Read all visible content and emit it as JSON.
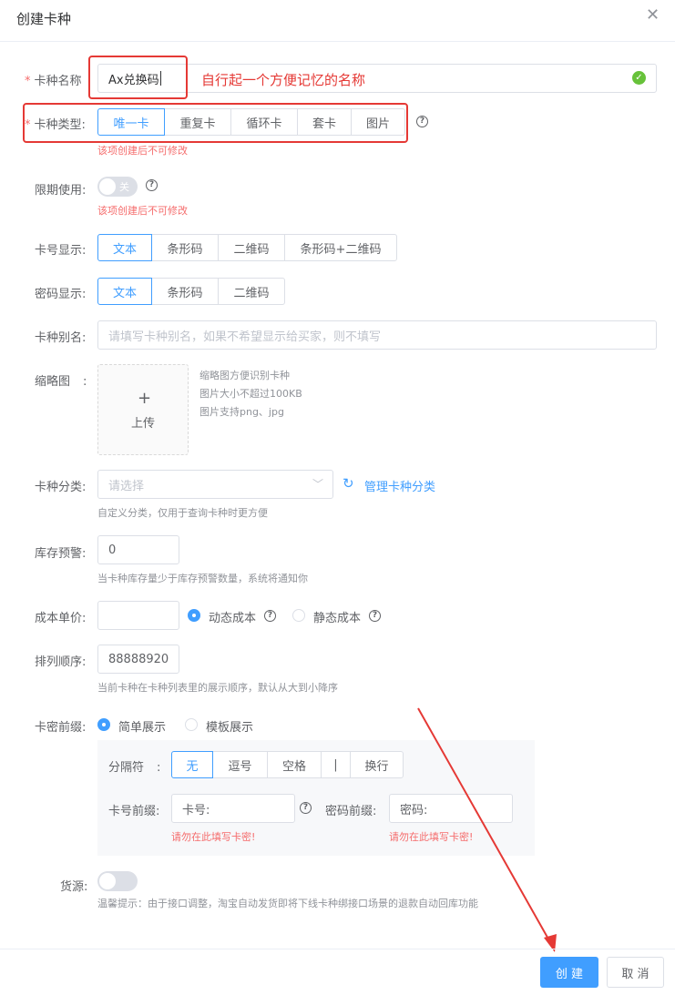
{
  "dialog": {
    "title": "创建卡种"
  },
  "name": {
    "label": "卡种名称",
    "value": "Ax兑换码",
    "annotation": "自行起一个方便记忆的名称"
  },
  "type": {
    "label": "卡种类型:",
    "options": [
      "唯一卡",
      "重复卡",
      "循环卡",
      "套卡",
      "图片"
    ],
    "selected": "唯一卡",
    "note": "该项创建后不可修改"
  },
  "limited": {
    "label": "限期使用:",
    "switch_text": "关",
    "note": "该项创建后不可修改"
  },
  "card_display": {
    "label": "卡号显示:",
    "options": [
      "文本",
      "条形码",
      "二维码",
      "条形码+二维码"
    ],
    "selected": "文本"
  },
  "pwd_display": {
    "label": "密码显示:",
    "options": [
      "文本",
      "条形码",
      "二维码"
    ],
    "selected": "文本"
  },
  "alias": {
    "label": "卡种别名:",
    "placeholder": "请填写卡种别名，如果不希望显示给买家，则不填写"
  },
  "thumb": {
    "label": "缩略图",
    "upload_icon": "+",
    "upload_label": "上传",
    "tips": [
      "缩略图方便识别卡种",
      "图片大小不超过100KB",
      "图片支持png、jpg"
    ]
  },
  "category": {
    "label": "卡种分类:",
    "placeholder": "请选择",
    "manage": "管理卡种分类",
    "hint": "自定义分类，仅用于查询卡种时更方便"
  },
  "stock": {
    "label": "库存预警:",
    "value": "0",
    "hint": "当卡种库存量少于库存预警数量，系统将通知你"
  },
  "cost": {
    "label": "成本单价:",
    "value": "",
    "opt_dynamic": "动态成本",
    "opt_static": "静态成本"
  },
  "order": {
    "label": "排列顺序:",
    "value": "88888920",
    "hint": "当前卡种在卡种列表里的展示顺序，默认从大到小降序"
  },
  "prefix": {
    "label": "卡密前缀:",
    "opt_simple": "简单展示",
    "opt_template": "模板展示",
    "sep_label": "分隔符",
    "sep_colon": ":",
    "separators": [
      "无",
      "逗号",
      "空格",
      "|",
      "换行"
    ],
    "sep_selected": "无",
    "card_label": "卡号前缀:",
    "card_value": "卡号:",
    "card_warn": "请勿在此填写卡密!",
    "pwd_label": "密码前缀:",
    "pwd_value": "密码:",
    "pwd_warn": "请勿在此填写卡密!"
  },
  "source": {
    "label": "货源:",
    "hint": "温馨提示：由于接口调整，淘宝自动发货即将下线卡种绑接口场景的退款自动回库功能"
  },
  "footer": {
    "create": "创 建",
    "cancel": "取 消"
  },
  "colors": {
    "primary": "#409eff",
    "danger": "#f56c6c",
    "annotation": "#e53935",
    "success": "#67c23a"
  }
}
